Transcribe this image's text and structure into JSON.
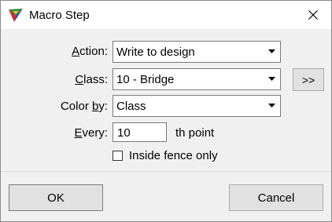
{
  "window": {
    "title": "Macro Step",
    "close_glyph": "✕"
  },
  "form": {
    "action": {
      "label_pre": "",
      "label_ul": "A",
      "label_post": "ction:",
      "value": "Write to design"
    },
    "class": {
      "label_pre": "",
      "label_ul": "C",
      "label_post": "lass:",
      "value": "10 - Bridge",
      "more_label": ">>"
    },
    "color_by": {
      "label_pre": "Color ",
      "label_ul": "b",
      "label_post": "y:",
      "value": "Class"
    },
    "every": {
      "label_pre": "",
      "label_ul": "E",
      "label_post": "very:",
      "value": "10",
      "suffix": "th point"
    },
    "inside_fence": {
      "label": "Inside fence only",
      "checked": false
    }
  },
  "buttons": {
    "ok": "OK",
    "cancel": "Cancel"
  },
  "icons": {
    "app": "app-logo-icon",
    "close": "close-icon",
    "dropdown": "chevron-down-icon"
  },
  "colors": {
    "dialog_bg": "#f0f0f0",
    "titlebar_bg": "#ffffff",
    "button_bg": "#e1e1e1"
  }
}
